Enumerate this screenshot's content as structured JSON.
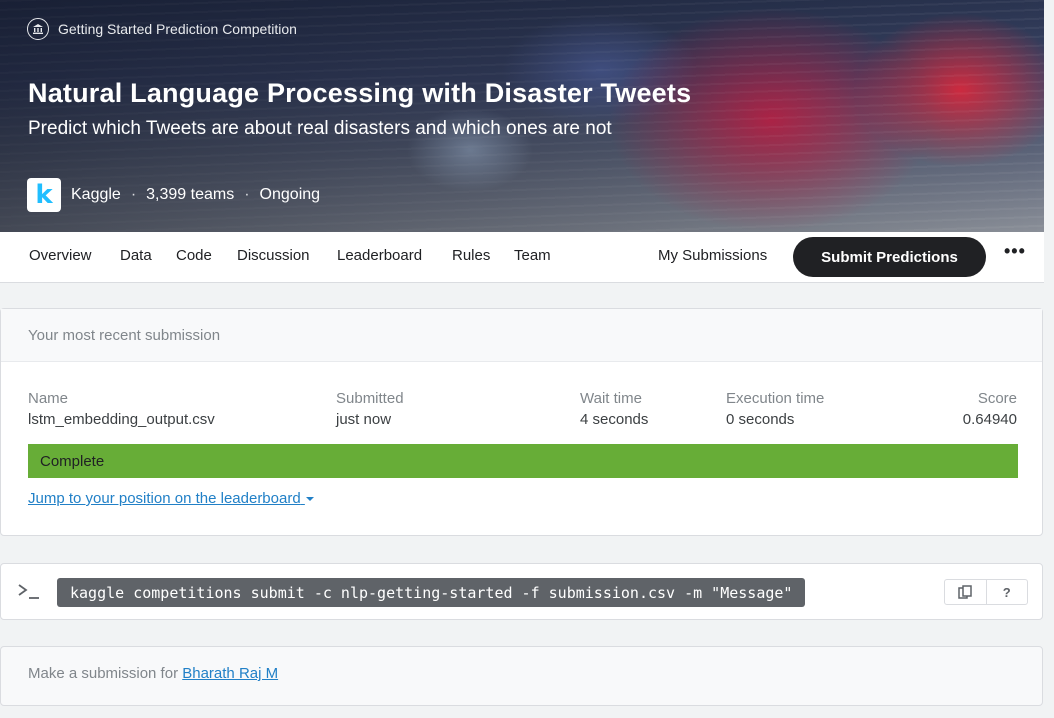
{
  "hero": {
    "tag": "Getting Started Prediction Competition",
    "tag_icon": "bank-icon",
    "title": "Natural Language Processing with Disaster Tweets",
    "subtitle": "Predict which Tweets are about real disasters and which ones are not",
    "host": "Kaggle",
    "teams": "3,399 teams",
    "status": "Ongoing",
    "separator": "·",
    "logo_letter": "k"
  },
  "nav": {
    "tabs": [
      "Overview",
      "Data",
      "Code",
      "Discussion",
      "Leaderboard",
      "Rules",
      "Team"
    ],
    "my_submissions": "My Submissions",
    "submit_button": "Submit Predictions",
    "more_icon": "•••"
  },
  "submission": {
    "header": "Your most recent submission",
    "columns": {
      "name": {
        "label": "Name",
        "value": "lstm_embedding_output.csv"
      },
      "submitted": {
        "label": "Submitted",
        "value": "just now"
      },
      "wait": {
        "label": "Wait time",
        "value": "4 seconds"
      },
      "execution": {
        "label": "Execution time",
        "value": "0 seconds"
      },
      "score": {
        "label": "Score",
        "value": "0.64940"
      }
    },
    "status": "Complete",
    "status_color": "#67ad37",
    "jump_link": "Jump to your position on the leaderboard"
  },
  "cli": {
    "command": "kaggle competitions submit -c nlp-getting-started -f submission.csv -m \"Message\"",
    "copy_icon": "clipboard-icon",
    "help_label": "?"
  },
  "footer": {
    "text": "Make a submission for ",
    "user": "Bharath Raj M"
  },
  "colors": {
    "accent": "#2180c7",
    "dark_button": "#202124",
    "success": "#67ad37"
  }
}
